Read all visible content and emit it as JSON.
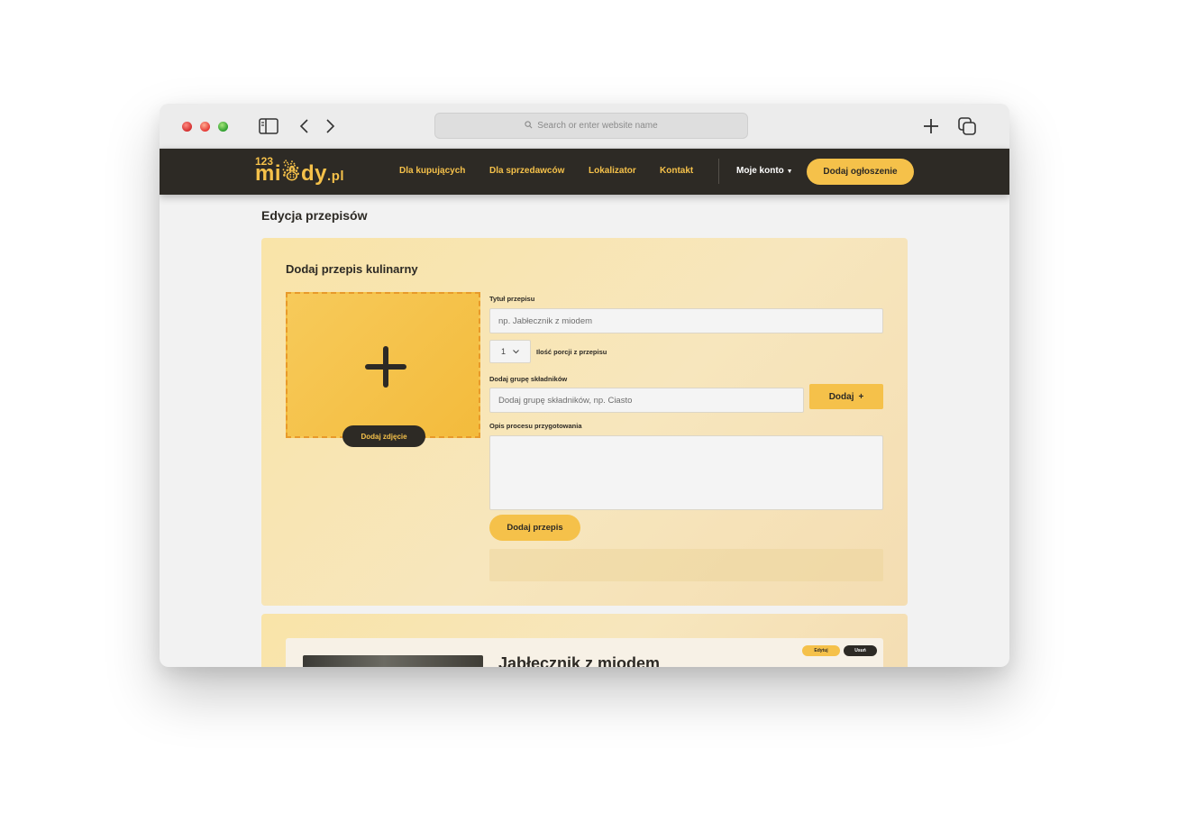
{
  "browser": {
    "search_placeholder": "Search or enter website name"
  },
  "navbar": {
    "logo_sup": "123",
    "logo_main": "mi☃dy",
    "logo_tld": ".pl",
    "links": [
      "Dla kupujących",
      "Dla sprzedawców",
      "Lokalizator",
      "Kontakt"
    ],
    "account": "Moje konto",
    "add_ad": "Dodaj ogłoszenie"
  },
  "page": {
    "title": "Edycja przepisów"
  },
  "form": {
    "heading": "Dodaj przepis kulinarny",
    "photo_button": "Dodaj zdjęcie",
    "title_label": "Tytuł przepisu",
    "title_placeholder": "np. Jabłecznik z miodem",
    "portions_value": "1",
    "portions_label": "Ilość porcji z przepisu",
    "group_label": "Dodaj grupę składników",
    "group_placeholder": "Dodaj grupę składników, np. Ciasto",
    "group_button": "Dodaj",
    "description_label": "Opis procesu przygotowania",
    "submit": "Dodaj przepis"
  },
  "recipes": [
    {
      "title": "Jabłecznik z miodem",
      "edit": "Edytuj",
      "delete": "Usuń"
    }
  ],
  "colors": {
    "accent": "#f5c14a",
    "dark": "#2d2a25"
  }
}
